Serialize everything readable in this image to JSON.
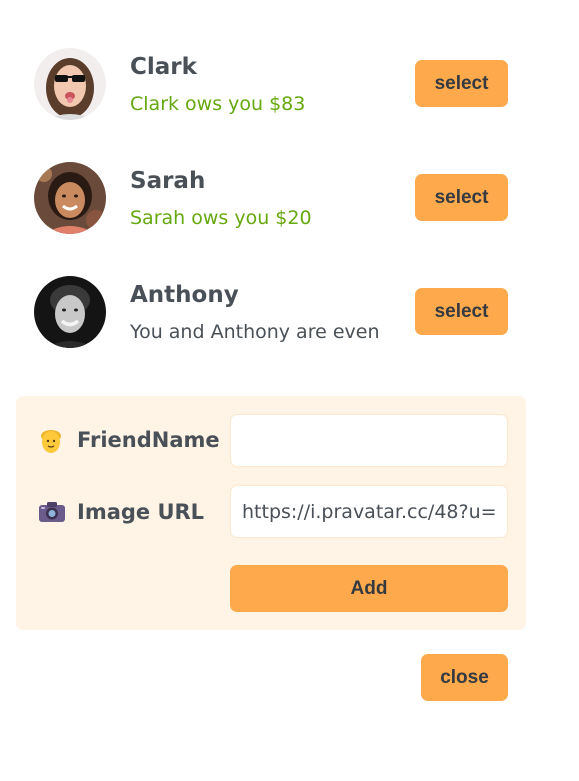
{
  "friends": [
    {
      "name": "Clark",
      "balance_text": "Clark ows you $83",
      "balance_status": "owes-you",
      "avatar_icon": "avatar-clark-photo",
      "select_label": "select"
    },
    {
      "name": "Sarah",
      "balance_text": "Sarah ows you $20",
      "balance_status": "owes-you",
      "avatar_icon": "avatar-sarah-photo",
      "select_label": "select"
    },
    {
      "name": "Anthony",
      "balance_text": "You and Anthony are even",
      "balance_status": "even",
      "avatar_icon": "avatar-anthony-photo",
      "select_label": "select"
    }
  ],
  "add_form": {
    "name_label": "FriendName",
    "name_icon": "person-emoji-icon",
    "name_value": "",
    "image_label": "Image URL",
    "image_icon": "camera-emoji-icon",
    "image_value": "https://i.pravatar.cc/48?u=",
    "add_label": "Add"
  },
  "close_label": "close",
  "colors": {
    "accent": "#ffa94d",
    "form_background": "#fff4e6",
    "positive": "#66a80f",
    "text": "#495057",
    "button_text": "#343a40"
  }
}
